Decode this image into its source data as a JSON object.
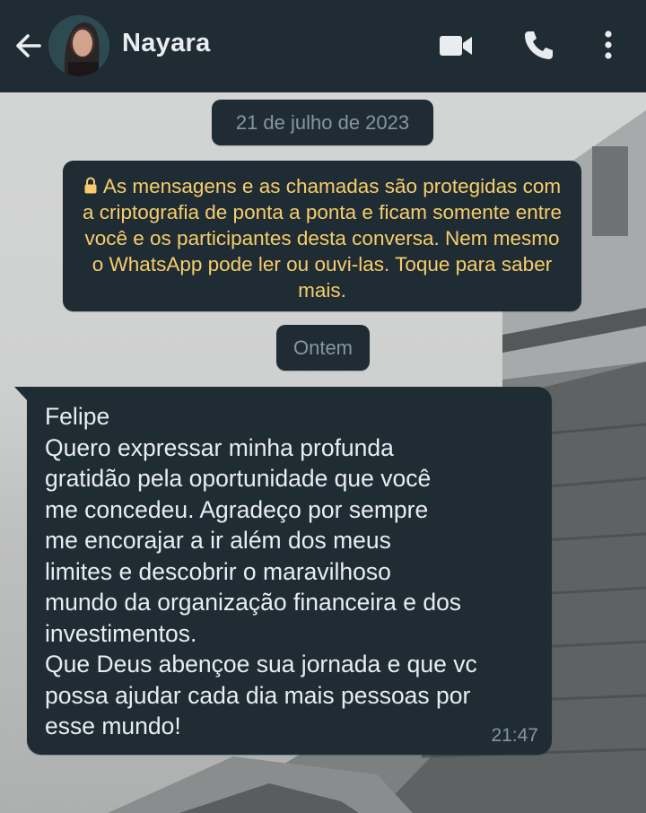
{
  "header": {
    "contact_name": "Nayara",
    "back_icon": "arrow-left-icon",
    "video_icon": "video-camera-icon",
    "call_icon": "phone-icon",
    "menu_icon": "more-vertical-icon",
    "bg_color": "#1f2c34"
  },
  "chat": {
    "date_chip": "21 de julho de 2023",
    "encryption_notice": "As mensagens e as chamadas são protegidas com a criptografia de ponta a ponta e ficam somente entre você e os participantes desta conversa. Nem mesmo o WhatsApp pode ler ou ouvi-las. Toque para saber mais.",
    "encryption_color": "#f7cd6b",
    "yesterday_chip": "Ontem",
    "messages": [
      {
        "direction": "incoming",
        "text": "Felipe\nQuero expressar minha profunda\ngratidão pela oportunidade que você\nme concedeu. Agradeço por sempre\nme encorajar a ir além dos meus\nlimites e descobrir o maravilhoso\nmundo da organização financeira e dos\ninvestimentos.\nQue Deus abençoe sua jornada e que vc\npossa ajudar cada dia mais pessoas por\nesse mundo!",
        "time": "21:47"
      }
    ]
  }
}
